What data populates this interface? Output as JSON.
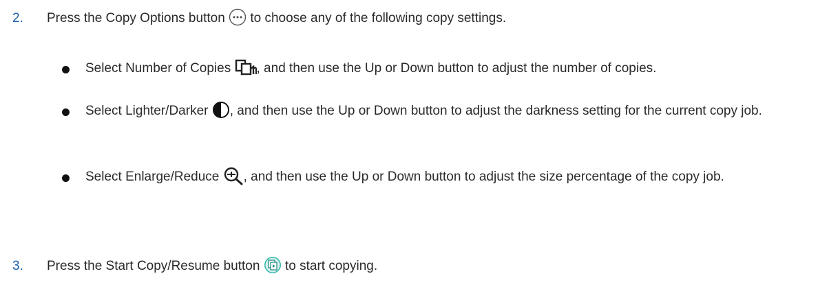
{
  "steps": [
    {
      "number": "2.",
      "text_before": "Press the Copy Options button",
      "icon": "copy-options-icon",
      "text_after": "to choose any of the following copy settings."
    },
    {
      "number": "3.",
      "text_before": "Press the Start Copy/Resume button",
      "icon": "start-copy-resume-icon",
      "text_after": "to start copying."
    }
  ],
  "bullets": [
    {
      "text_before": "Select Number of Copies",
      "icon": "number-of-copies-icon",
      "text_after": ", and then use the Up or Down button to adjust the number of copies."
    },
    {
      "text_before": "Select Lighter/Darker",
      "icon": "lighter-darker-icon",
      "text_after": ", and then use the Up or Down button to adjust the darkness setting for the current copy job."
    },
    {
      "text_before": "Select Enlarge/Reduce",
      "icon": "enlarge-reduce-icon",
      "text_after": ", and then use the Up or Down button to adjust the size percentage of the copy job."
    }
  ],
  "colors": {
    "step_number": "#1b5fa8",
    "text": "#2a2a2a",
    "start_icon": "#2fb8a8"
  }
}
